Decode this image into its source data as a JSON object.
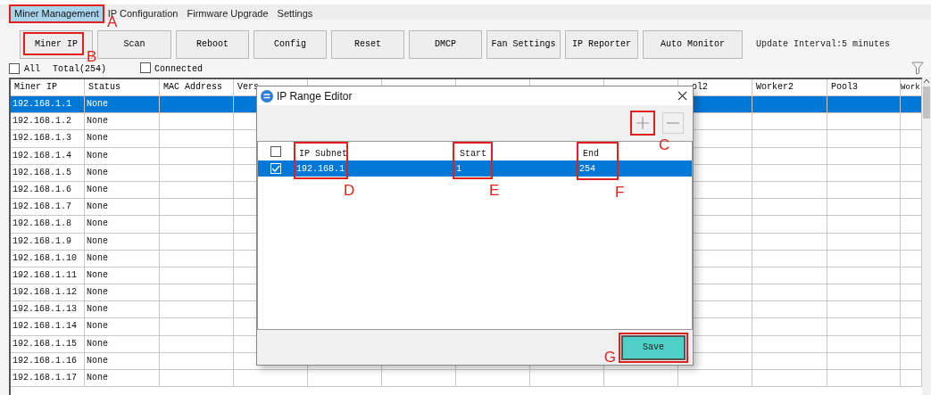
{
  "tabs": [
    {
      "label": "Miner Management",
      "selected": true
    },
    {
      "label": "IP Configuration",
      "selected": false
    },
    {
      "label": "Firmware Upgrade",
      "selected": false
    },
    {
      "label": "Settings",
      "selected": false
    }
  ],
  "toolbar": {
    "buttons": [
      "Miner IP",
      "Scan",
      "Reboot",
      "Config",
      "Reset",
      "DMCP",
      "Fan Settings",
      "IP Reporter",
      "Auto Monitor"
    ],
    "update_interval": "Update Interval:5 minutes"
  },
  "filters": {
    "all": {
      "label": "All",
      "checked": false
    },
    "total": "Total(254)",
    "connected": {
      "label": "Connected",
      "checked": false
    }
  },
  "table": {
    "columns_left": [
      "Miner IP",
      "Status",
      "MAC Address",
      "Vers"
    ],
    "columns_right": [
      "ol2",
      "Worker2",
      "Pool3",
      "Work"
    ],
    "rows": [
      {
        "ip": "192.168.1.1",
        "status": "None",
        "selected": true
      },
      {
        "ip": "192.168.1.2",
        "status": "None",
        "selected": false
      },
      {
        "ip": "192.168.1.3",
        "status": "None",
        "selected": false
      },
      {
        "ip": "192.168.1.4",
        "status": "None",
        "selected": false
      },
      {
        "ip": "192.168.1.5",
        "status": "None",
        "selected": false
      },
      {
        "ip": "192.168.1.6",
        "status": "None",
        "selected": false
      },
      {
        "ip": "192.168.1.7",
        "status": "None",
        "selected": false
      },
      {
        "ip": "192.168.1.8",
        "status": "None",
        "selected": false
      },
      {
        "ip": "192.168.1.9",
        "status": "None",
        "selected": false
      },
      {
        "ip": "192.168.1.10",
        "status": "None",
        "selected": false
      },
      {
        "ip": "192.168.1.11",
        "status": "None",
        "selected": false
      },
      {
        "ip": "192.168.1.12",
        "status": "None",
        "selected": false
      },
      {
        "ip": "192.168.1.13",
        "status": "None",
        "selected": false
      },
      {
        "ip": "192.168.1.14",
        "status": "None",
        "selected": false
      },
      {
        "ip": "192.168.1.15",
        "status": "None",
        "selected": false
      },
      {
        "ip": "192.168.1.16",
        "status": "None",
        "selected": false
      },
      {
        "ip": "192.168.1.17",
        "status": "None",
        "selected": false
      }
    ]
  },
  "dialog": {
    "title": "IP Range Editor",
    "header_checked": false,
    "columns": [
      "IP Subnet",
      "Start",
      "End"
    ],
    "rows": [
      {
        "subnet": "192.168.1",
        "start": "1",
        "end": "254",
        "checked": true,
        "selected": true
      }
    ],
    "save": "Save"
  },
  "annotations": [
    "A",
    "B",
    "C",
    "D",
    "E",
    "F",
    "G"
  ]
}
